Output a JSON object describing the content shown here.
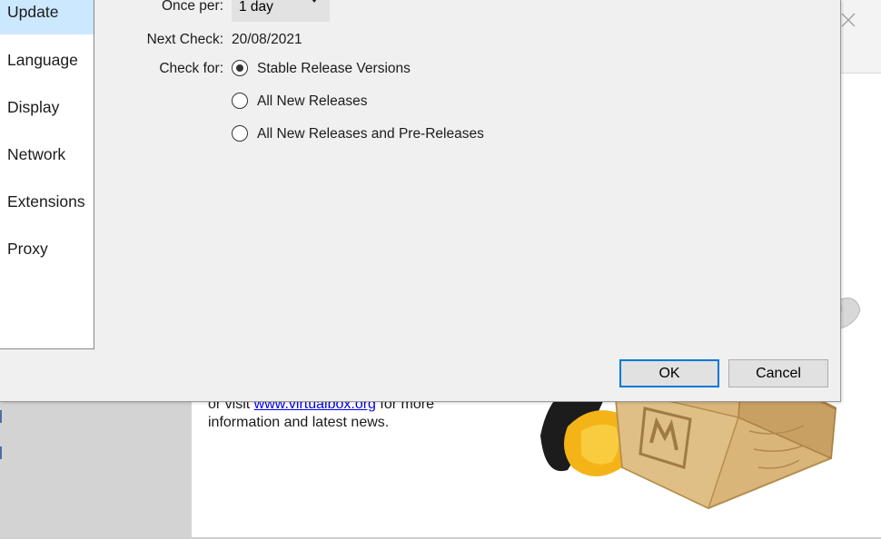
{
  "background": {
    "welcome_prefix": "or visit ",
    "welcome_link": "www.virtualbox.org",
    "welcome_suffix": " for more",
    "welcome_line2": "information and latest news."
  },
  "sidebar": {
    "items": [
      {
        "label": "Update",
        "selected": true
      },
      {
        "label": "Language",
        "selected": false
      },
      {
        "label": "Display",
        "selected": false
      },
      {
        "label": "Network",
        "selected": false
      },
      {
        "label": "Extensions",
        "selected": false
      },
      {
        "label": "Proxy",
        "selected": false
      }
    ]
  },
  "update": {
    "once_per_label": "Once per:",
    "once_per_value": "1 day",
    "next_check_label": "Next Check:",
    "next_check_value": "20/08/2021",
    "check_for_label": "Check for:",
    "options": [
      {
        "label": "Stable Release Versions",
        "checked": true
      },
      {
        "label": "All New Releases",
        "checked": false
      },
      {
        "label": "All New Releases and Pre-Releases",
        "checked": false
      }
    ]
  },
  "buttons": {
    "ok_label": "OK",
    "cancel_label": "Cancel"
  },
  "colors": {
    "selection": "#cce8ff",
    "dialog_bg": "#f0f0f0",
    "default_button_border": "#0078d7"
  }
}
